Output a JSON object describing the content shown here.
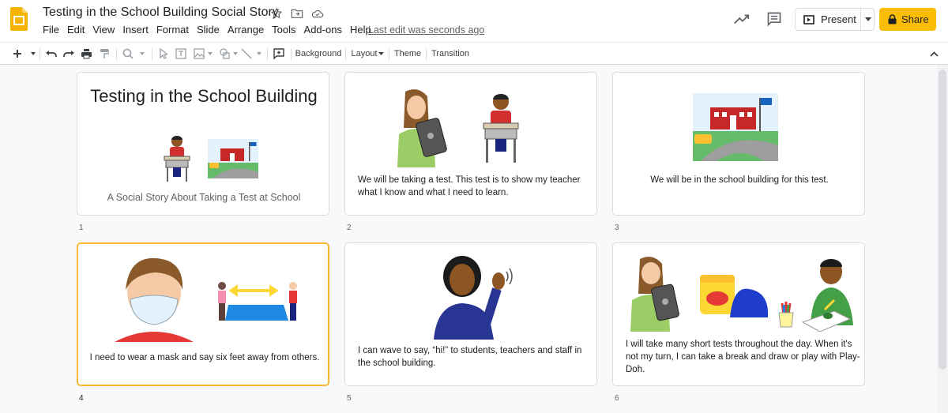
{
  "doc": {
    "title": "Testing in the School Building Social Story",
    "last_edit": "Last edit was seconds ago"
  },
  "menu": [
    "File",
    "Edit",
    "View",
    "Insert",
    "Format",
    "Slide",
    "Arrange",
    "Tools",
    "Add-ons",
    "Help"
  ],
  "actions": {
    "present_label": "Present",
    "share_label": "Share"
  },
  "toolbar": {
    "background_label": "Background",
    "layout_label": "Layout",
    "theme_label": "Theme",
    "transition_label": "Transition"
  },
  "colors": {
    "share_yellow": "#fbbc04",
    "selected_border": "#f9b832",
    "slides_logo": "#f4b400"
  },
  "slides": [
    {
      "number": "1",
      "title": "Testing in the School Building",
      "subtitle": "A Social Story About Taking a Test at School"
    },
    {
      "number": "2",
      "text": "We will be taking a test. This test is to show my teacher what I know and what I need to learn."
    },
    {
      "number": "3",
      "text": "We will be in the school building for this test."
    },
    {
      "number": "4",
      "text": "I need to wear a mask and say six feet away from others."
    },
    {
      "number": "5",
      "text": "I can wave to say, “hi!” to students, teachers and staff in the school building."
    },
    {
      "number": "6",
      "text": "I will take many short tests throughout the day. When it's not my turn, I can take a break and draw or play with Play-Doh."
    }
  ]
}
